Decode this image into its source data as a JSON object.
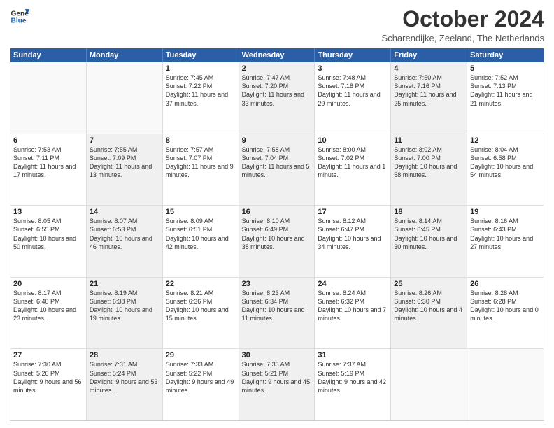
{
  "header": {
    "logo_line1": "General",
    "logo_line2": "Blue",
    "month_year": "October 2024",
    "location": "Scharendijke, Zeeland, The Netherlands"
  },
  "days_of_week": [
    "Sunday",
    "Monday",
    "Tuesday",
    "Wednesday",
    "Thursday",
    "Friday",
    "Saturday"
  ],
  "rows": [
    [
      {
        "day": "",
        "sunrise": "",
        "sunset": "",
        "daylight": "",
        "shaded": false,
        "empty": true
      },
      {
        "day": "",
        "sunrise": "",
        "sunset": "",
        "daylight": "",
        "shaded": false,
        "empty": true
      },
      {
        "day": "1",
        "sunrise": "Sunrise: 7:45 AM",
        "sunset": "Sunset: 7:22 PM",
        "daylight": "Daylight: 11 hours and 37 minutes.",
        "shaded": false,
        "empty": false
      },
      {
        "day": "2",
        "sunrise": "Sunrise: 7:47 AM",
        "sunset": "Sunset: 7:20 PM",
        "daylight": "Daylight: 11 hours and 33 minutes.",
        "shaded": true,
        "empty": false
      },
      {
        "day": "3",
        "sunrise": "Sunrise: 7:48 AM",
        "sunset": "Sunset: 7:18 PM",
        "daylight": "Daylight: 11 hours and 29 minutes.",
        "shaded": false,
        "empty": false
      },
      {
        "day": "4",
        "sunrise": "Sunrise: 7:50 AM",
        "sunset": "Sunset: 7:16 PM",
        "daylight": "Daylight: 11 hours and 25 minutes.",
        "shaded": true,
        "empty": false
      },
      {
        "day": "5",
        "sunrise": "Sunrise: 7:52 AM",
        "sunset": "Sunset: 7:13 PM",
        "daylight": "Daylight: 11 hours and 21 minutes.",
        "shaded": false,
        "empty": false
      }
    ],
    [
      {
        "day": "6",
        "sunrise": "Sunrise: 7:53 AM",
        "sunset": "Sunset: 7:11 PM",
        "daylight": "Daylight: 11 hours and 17 minutes.",
        "shaded": false,
        "empty": false
      },
      {
        "day": "7",
        "sunrise": "Sunrise: 7:55 AM",
        "sunset": "Sunset: 7:09 PM",
        "daylight": "Daylight: 11 hours and 13 minutes.",
        "shaded": true,
        "empty": false
      },
      {
        "day": "8",
        "sunrise": "Sunrise: 7:57 AM",
        "sunset": "Sunset: 7:07 PM",
        "daylight": "Daylight: 11 hours and 9 minutes.",
        "shaded": false,
        "empty": false
      },
      {
        "day": "9",
        "sunrise": "Sunrise: 7:58 AM",
        "sunset": "Sunset: 7:04 PM",
        "daylight": "Daylight: 11 hours and 5 minutes.",
        "shaded": true,
        "empty": false
      },
      {
        "day": "10",
        "sunrise": "Sunrise: 8:00 AM",
        "sunset": "Sunset: 7:02 PM",
        "daylight": "Daylight: 11 hours and 1 minute.",
        "shaded": false,
        "empty": false
      },
      {
        "day": "11",
        "sunrise": "Sunrise: 8:02 AM",
        "sunset": "Sunset: 7:00 PM",
        "daylight": "Daylight: 10 hours and 58 minutes.",
        "shaded": true,
        "empty": false
      },
      {
        "day": "12",
        "sunrise": "Sunrise: 8:04 AM",
        "sunset": "Sunset: 6:58 PM",
        "daylight": "Daylight: 10 hours and 54 minutes.",
        "shaded": false,
        "empty": false
      }
    ],
    [
      {
        "day": "13",
        "sunrise": "Sunrise: 8:05 AM",
        "sunset": "Sunset: 6:55 PM",
        "daylight": "Daylight: 10 hours and 50 minutes.",
        "shaded": false,
        "empty": false
      },
      {
        "day": "14",
        "sunrise": "Sunrise: 8:07 AM",
        "sunset": "Sunset: 6:53 PM",
        "daylight": "Daylight: 10 hours and 46 minutes.",
        "shaded": true,
        "empty": false
      },
      {
        "day": "15",
        "sunrise": "Sunrise: 8:09 AM",
        "sunset": "Sunset: 6:51 PM",
        "daylight": "Daylight: 10 hours and 42 minutes.",
        "shaded": false,
        "empty": false
      },
      {
        "day": "16",
        "sunrise": "Sunrise: 8:10 AM",
        "sunset": "Sunset: 6:49 PM",
        "daylight": "Daylight: 10 hours and 38 minutes.",
        "shaded": true,
        "empty": false
      },
      {
        "day": "17",
        "sunrise": "Sunrise: 8:12 AM",
        "sunset": "Sunset: 6:47 PM",
        "daylight": "Daylight: 10 hours and 34 minutes.",
        "shaded": false,
        "empty": false
      },
      {
        "day": "18",
        "sunrise": "Sunrise: 8:14 AM",
        "sunset": "Sunset: 6:45 PM",
        "daylight": "Daylight: 10 hours and 30 minutes.",
        "shaded": true,
        "empty": false
      },
      {
        "day": "19",
        "sunrise": "Sunrise: 8:16 AM",
        "sunset": "Sunset: 6:43 PM",
        "daylight": "Daylight: 10 hours and 27 minutes.",
        "shaded": false,
        "empty": false
      }
    ],
    [
      {
        "day": "20",
        "sunrise": "Sunrise: 8:17 AM",
        "sunset": "Sunset: 6:40 PM",
        "daylight": "Daylight: 10 hours and 23 minutes.",
        "shaded": false,
        "empty": false
      },
      {
        "day": "21",
        "sunrise": "Sunrise: 8:19 AM",
        "sunset": "Sunset: 6:38 PM",
        "daylight": "Daylight: 10 hours and 19 minutes.",
        "shaded": true,
        "empty": false
      },
      {
        "day": "22",
        "sunrise": "Sunrise: 8:21 AM",
        "sunset": "Sunset: 6:36 PM",
        "daylight": "Daylight: 10 hours and 15 minutes.",
        "shaded": false,
        "empty": false
      },
      {
        "day": "23",
        "sunrise": "Sunrise: 8:23 AM",
        "sunset": "Sunset: 6:34 PM",
        "daylight": "Daylight: 10 hours and 11 minutes.",
        "shaded": true,
        "empty": false
      },
      {
        "day": "24",
        "sunrise": "Sunrise: 8:24 AM",
        "sunset": "Sunset: 6:32 PM",
        "daylight": "Daylight: 10 hours and 7 minutes.",
        "shaded": false,
        "empty": false
      },
      {
        "day": "25",
        "sunrise": "Sunrise: 8:26 AM",
        "sunset": "Sunset: 6:30 PM",
        "daylight": "Daylight: 10 hours and 4 minutes.",
        "shaded": true,
        "empty": false
      },
      {
        "day": "26",
        "sunrise": "Sunrise: 8:28 AM",
        "sunset": "Sunset: 6:28 PM",
        "daylight": "Daylight: 10 hours and 0 minutes.",
        "shaded": false,
        "empty": false
      }
    ],
    [
      {
        "day": "27",
        "sunrise": "Sunrise: 7:30 AM",
        "sunset": "Sunset: 5:26 PM",
        "daylight": "Daylight: 9 hours and 56 minutes.",
        "shaded": false,
        "empty": false
      },
      {
        "day": "28",
        "sunrise": "Sunrise: 7:31 AM",
        "sunset": "Sunset: 5:24 PM",
        "daylight": "Daylight: 9 hours and 53 minutes.",
        "shaded": true,
        "empty": false
      },
      {
        "day": "29",
        "sunrise": "Sunrise: 7:33 AM",
        "sunset": "Sunset: 5:22 PM",
        "daylight": "Daylight: 9 hours and 49 minutes.",
        "shaded": false,
        "empty": false
      },
      {
        "day": "30",
        "sunrise": "Sunrise: 7:35 AM",
        "sunset": "Sunset: 5:21 PM",
        "daylight": "Daylight: 9 hours and 45 minutes.",
        "shaded": true,
        "empty": false
      },
      {
        "day": "31",
        "sunrise": "Sunrise: 7:37 AM",
        "sunset": "Sunset: 5:19 PM",
        "daylight": "Daylight: 9 hours and 42 minutes.",
        "shaded": false,
        "empty": false
      },
      {
        "day": "",
        "sunrise": "",
        "sunset": "",
        "daylight": "",
        "shaded": false,
        "empty": true
      },
      {
        "day": "",
        "sunrise": "",
        "sunset": "",
        "daylight": "",
        "shaded": false,
        "empty": true
      }
    ]
  ]
}
